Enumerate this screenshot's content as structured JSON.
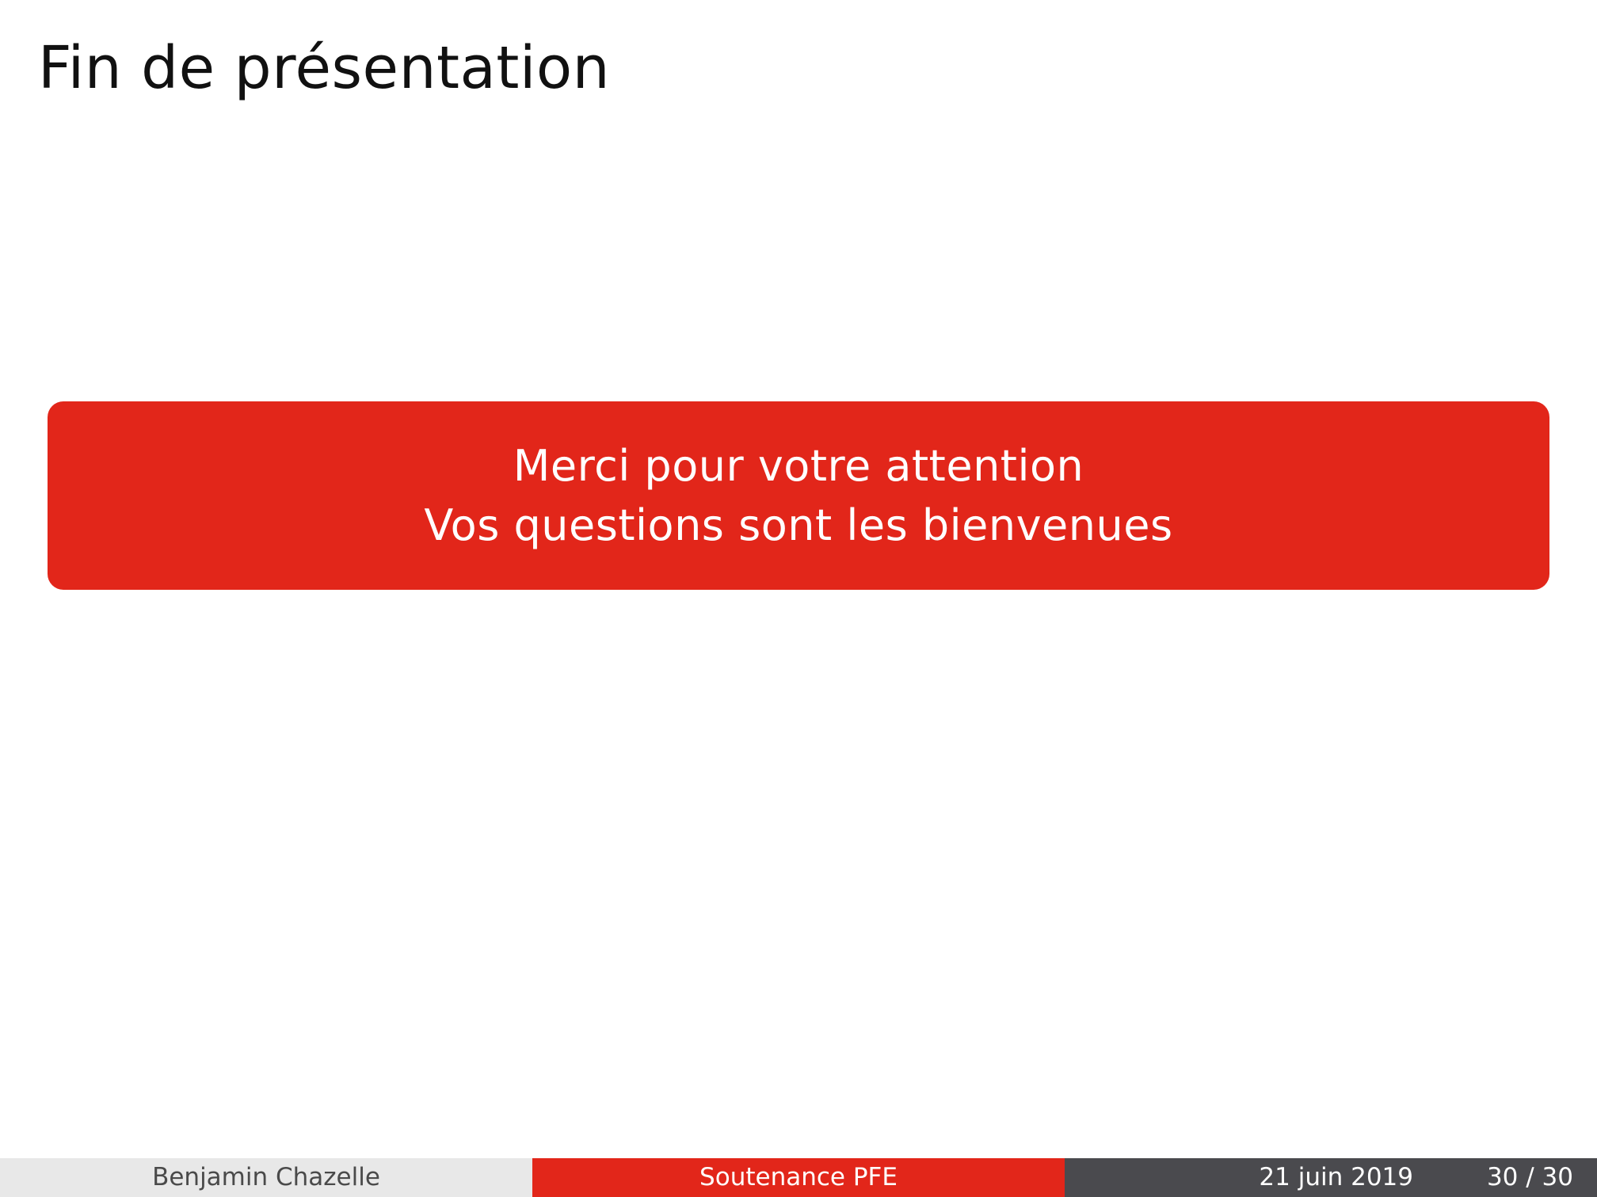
{
  "slide": {
    "title": "Fin de présentation",
    "box": {
      "line1": "Merci pour votre attention",
      "line2": "Vos questions sont les bienvenues"
    }
  },
  "footer": {
    "author": "Benjamin Chazelle",
    "event": "Soutenance PFE",
    "date": "21 juin 2019",
    "page": "30 / 30"
  },
  "colors": {
    "accent_red": "#e2261a",
    "footer_light_gray": "#e8e8e8",
    "footer_dark_gray": "#4a4a4e",
    "background": "#ffffff"
  }
}
